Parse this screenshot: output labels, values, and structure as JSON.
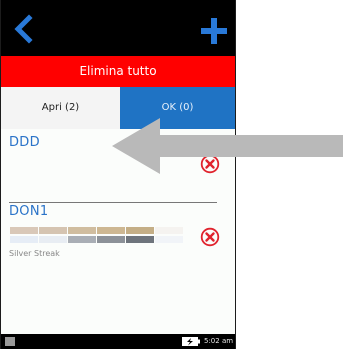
{
  "header": {
    "back_icon": "chevron-left-icon",
    "add_icon": "plus-icon",
    "accent_color": "#2979d8"
  },
  "actions": {
    "delete_all_label": "Elimina tutto",
    "delete_all_color": "#ff0000"
  },
  "tabs": [
    {
      "label": "Apri (2)",
      "selected": true
    },
    {
      "label": "OK (0)",
      "selected": false,
      "color": "#1f73c4"
    }
  ],
  "items": [
    {
      "name": "DDD",
      "delete_icon": "remove-circle-icon"
    },
    {
      "name": "DON1",
      "delete_icon": "remove-circle-icon",
      "color_name": "Silver Streak",
      "swatch_colors": [
        [
          "#d9c8b8",
          "#d5c4b1",
          "#d0bd9f",
          "#cdb792",
          "#c4ae86",
          "#f5f3f0"
        ],
        [
          "#e6edf6",
          "#e8edf3",
          "#a9aeb5",
          "#8c9198",
          "#6e747c",
          "#f1f4f8"
        ]
      ]
    }
  ],
  "status_bar": {
    "time": "5:02 am",
    "battery_icon": "battery-charging-icon"
  },
  "annotation": {
    "arrow_icon": "arrow-left-icon",
    "arrow_color": "#b9b9b9"
  }
}
